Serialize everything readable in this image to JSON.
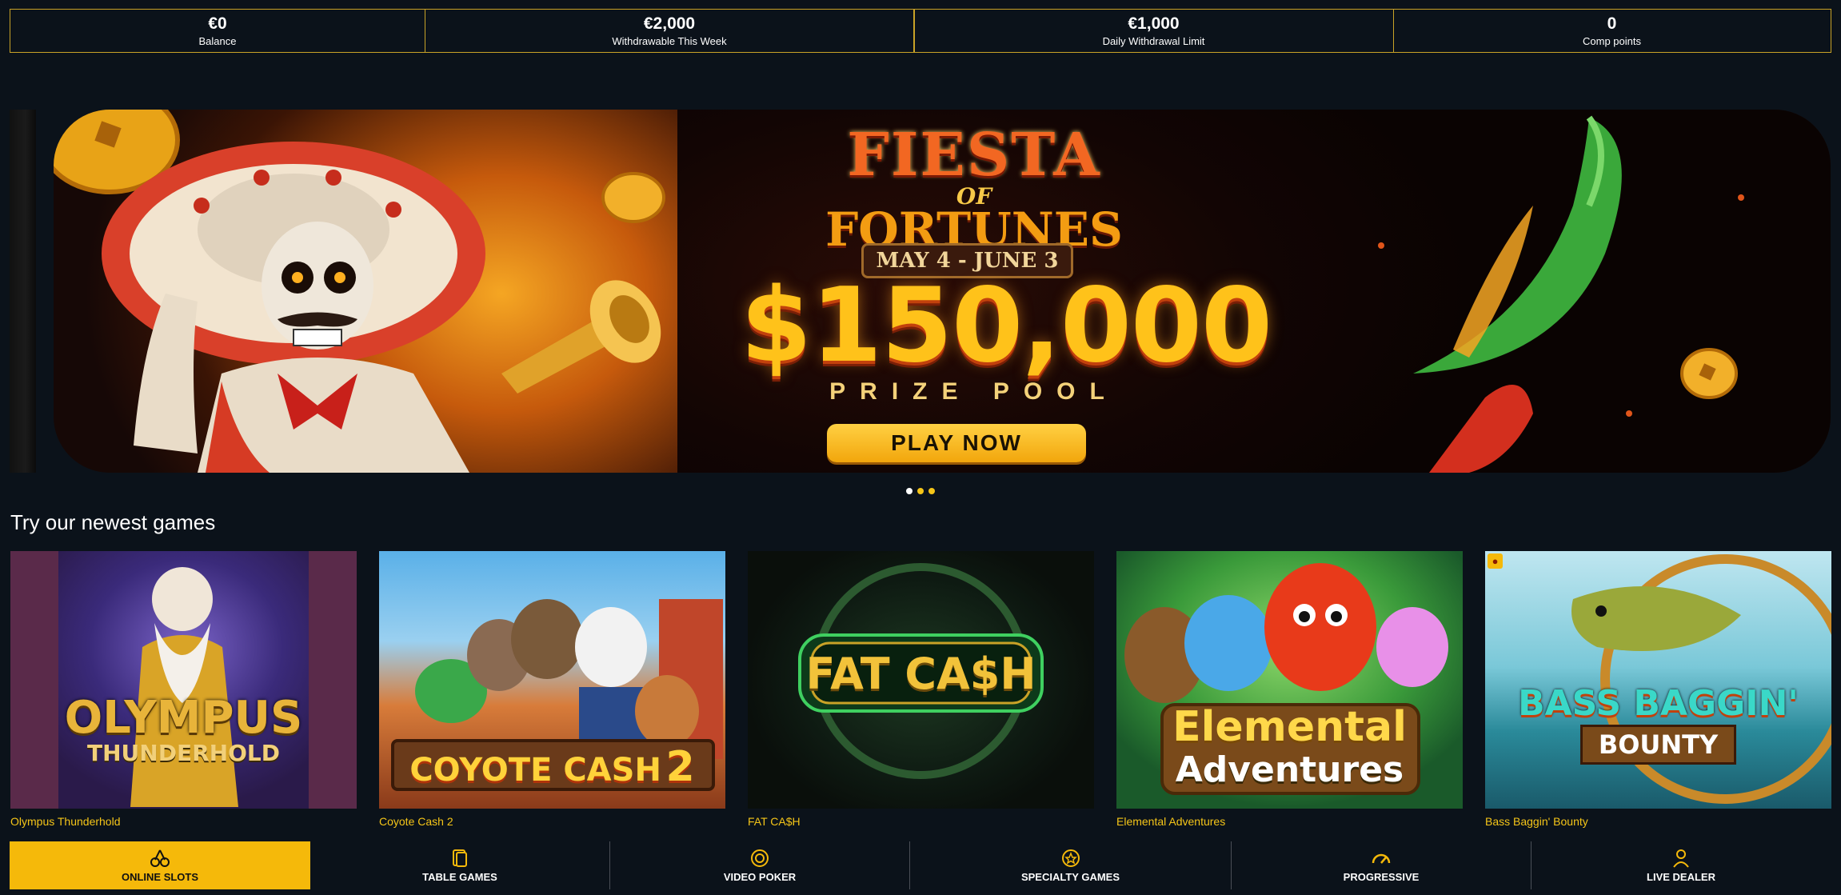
{
  "stats": [
    {
      "value": "€0",
      "label": "Balance"
    },
    {
      "value": "€2,000",
      "label": "Withdrawable This Week"
    },
    {
      "value": "€1,000",
      "label": "Daily Withdrawal Limit"
    },
    {
      "value": "0",
      "label": "Comp points"
    }
  ],
  "banner": {
    "title_line1": "FIESTA",
    "title_line2": "OF",
    "title_line3": "FORTUNES",
    "dates": "MAY 4 - JUNE 3",
    "amount": "$150,000",
    "subtitle": "PRIZE POOL",
    "cta": "PLAY NOW"
  },
  "carousel": {
    "count": 3,
    "active_index": 0
  },
  "newest_games": {
    "title": "Try our newest games",
    "items": [
      {
        "name": "Olympus Thunderhold",
        "logo_line1": "OLYMPUS",
        "logo_line2": "THUNDERHOLD"
      },
      {
        "name": "Coyote Cash 2",
        "logo_line1": "COYOTE CASH",
        "logo_line2": "2"
      },
      {
        "name": "FAT CA$H",
        "logo_line1": "FAT CA$H",
        "logo_line2": ""
      },
      {
        "name": "Elemental Adventures",
        "logo_line1": "Elemental",
        "logo_line2": "Adventures"
      },
      {
        "name": "Bass Baggin' Bounty",
        "logo_line1": "BASS BAGGIN'",
        "logo_line2": "BOUNTY"
      }
    ]
  },
  "bottom_nav": [
    {
      "label": "ONLINE SLOTS",
      "icon": "cherries-icon",
      "active": true
    },
    {
      "label": "TABLE GAMES",
      "icon": "cards-icon",
      "active": false
    },
    {
      "label": "VIDEO POKER",
      "icon": "poker-chip-icon",
      "active": false
    },
    {
      "label": "SPECIALTY GAMES",
      "icon": "star-chip-icon",
      "active": false
    },
    {
      "label": "PROGRESSIVE",
      "icon": "gauge-icon",
      "active": false
    },
    {
      "label": "LIVE DEALER",
      "icon": "dealer-icon",
      "active": false
    }
  ],
  "colors": {
    "accent": "#f5b90a",
    "border_gold": "#c9a227",
    "background": "#0b121a"
  }
}
